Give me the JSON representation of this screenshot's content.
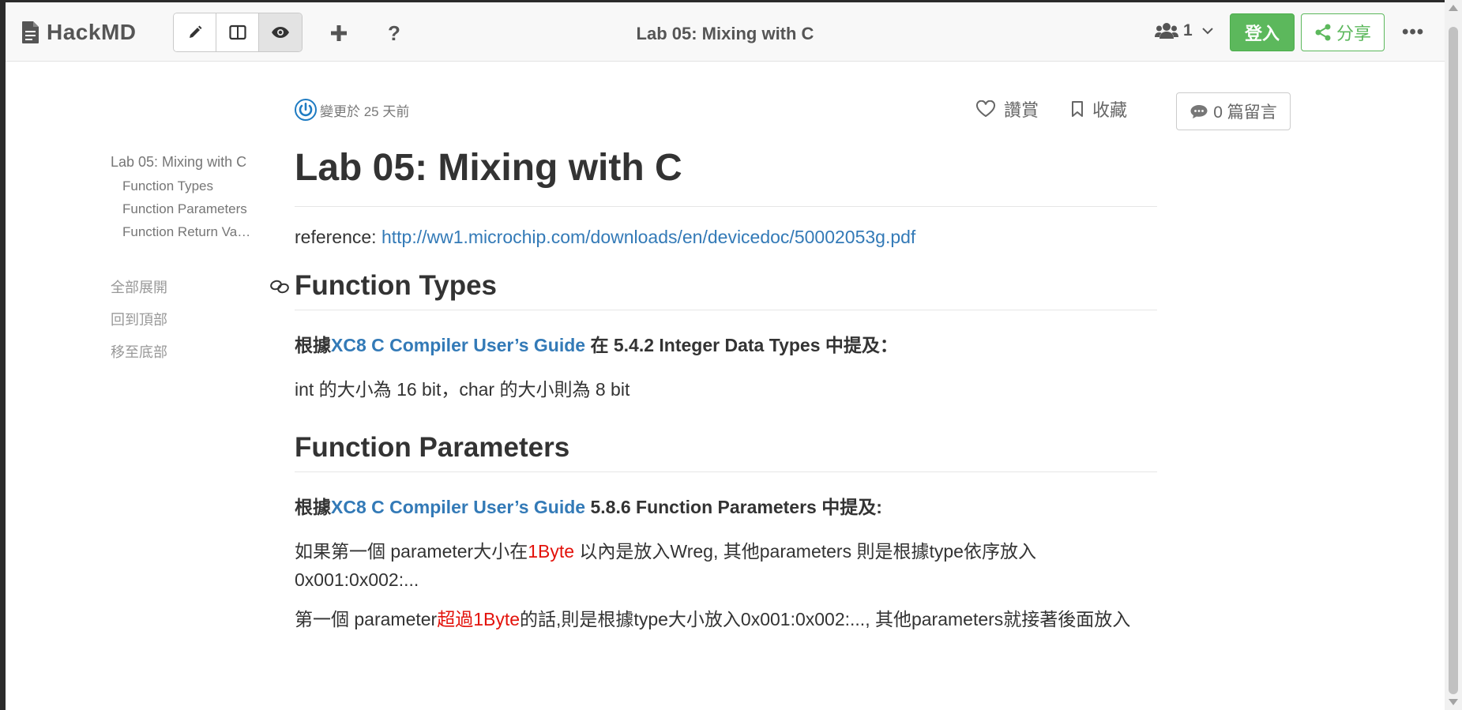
{
  "navbar": {
    "brand": "HackMD",
    "mode_buttons": [
      "edit-mode",
      "split-mode",
      "view-mode"
    ],
    "title": "Lab 05: Mixing with C",
    "online_count": "1",
    "login_label": "登入",
    "share_label": "分享",
    "more_label": "•••"
  },
  "toc": {
    "h1": "Lab 05: Mixing with C",
    "items": [
      "Function Types",
      "Function Parameters",
      "Function Return Va…"
    ],
    "expand_all": "全部展開",
    "back_to_top": "回到頂部",
    "go_to_bottom": "移至底部"
  },
  "meta": {
    "changed": "變更於 25 天前",
    "like_label": "讚賞",
    "bookmark_label": "收藏",
    "comment_label": "0 篇留言"
  },
  "doc": {
    "title": "Lab 05: Mixing with C",
    "reference_prefix": "reference: ",
    "reference_url": "http://ww1.microchip.com/downloads/en/devicedoc/50002053g.pdf",
    "section1": {
      "heading": "Function Types",
      "p1_prefix": "根據",
      "p1_link": "XC8 C Compiler User’s Guide",
      "p1_suffix": " 在 5.4.2 Integer Data Types 中提及：",
      "p2": "int 的大小為 16 bit，char 的大小則為 8 bit"
    },
    "section2": {
      "heading": "Function Parameters",
      "p1_prefix": "根據",
      "p1_link": "XC8 C Compiler User’s Guide",
      "p1_suffix": " 5.8.6 Function Parameters 中提及:",
      "p2_a": "如果第一個 parameter大小在",
      "p2_red": "1Byte",
      "p2_b": " 以內是放入Wreg, 其他parameters 則是根據type依序放入 0x001:0x002:...",
      "p3_a": "第一個 parameter",
      "p3_red": "超過1Byte",
      "p3_b": "的話,則是根據type大小放入0x001:0x002:..., 其他parameters就接著後面放入"
    }
  },
  "colors": {
    "accent_green": "#5cb85c",
    "link_blue": "#337ab7",
    "highlight_red": "#e3120b"
  }
}
